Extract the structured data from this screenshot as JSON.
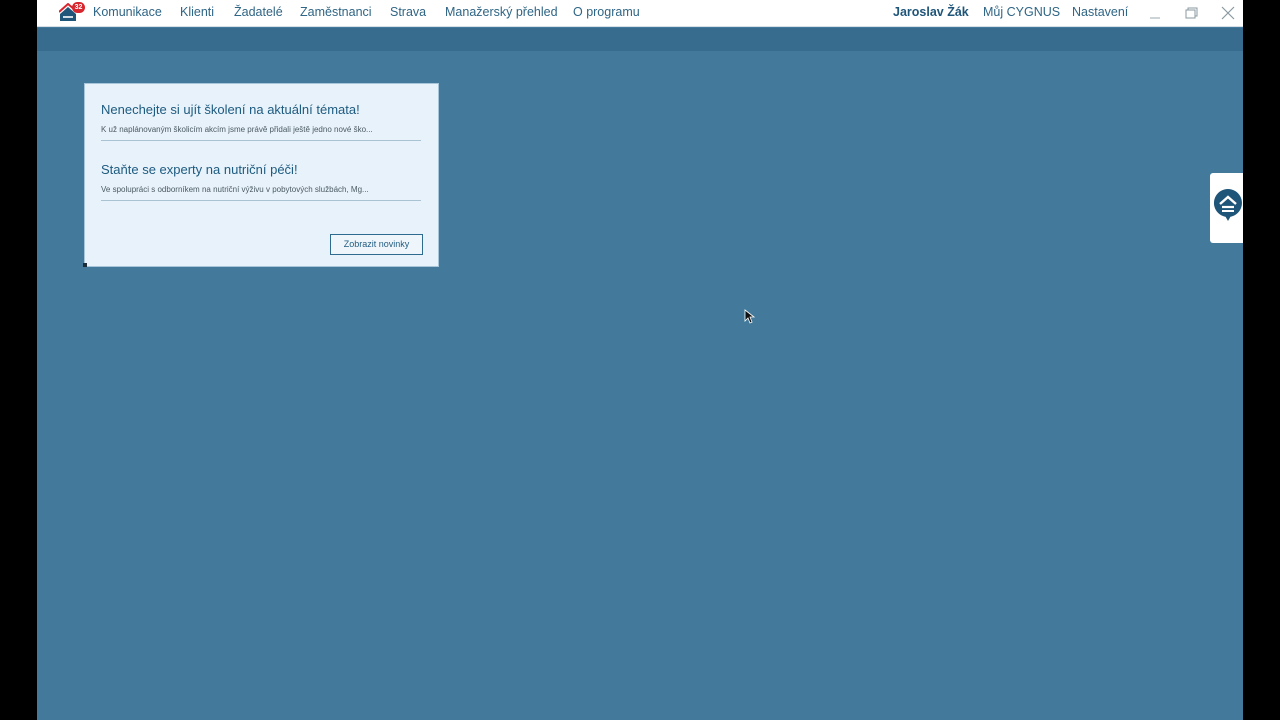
{
  "app": {
    "notification_count": "32",
    "colors": {
      "background": "#437a9b",
      "subbar": "#386c8f",
      "menubar": "#ffffff",
      "accent": "#1f5579",
      "badge": "#d8262e"
    }
  },
  "menu": {
    "items": [
      {
        "label": "Komunikace"
      },
      {
        "label": "Klienti"
      },
      {
        "label": "Žadatelé"
      },
      {
        "label": "Zaměstnanci"
      },
      {
        "label": "Strava"
      },
      {
        "label": "Manažerský přehled"
      },
      {
        "label": "O programu"
      }
    ],
    "user": "Jaroslav Žák",
    "my_cygnus": "Můj CYGNUS",
    "settings": "Nastavení"
  },
  "window_controls": {
    "minimize": "minimize-icon",
    "restore": "restore-icon",
    "close": "close-icon"
  },
  "news": {
    "items": [
      {
        "title": "Nenechejte si ujít školení na aktuální témata!",
        "text": "K už naplánovaným školicím akcím jsme právě přidali ještě jedno nové ško..."
      },
      {
        "title": "Staňte se experty na nutriční péči!",
        "text": "Ve spolupráci s odborníkem na nutriční výživu v pobytových službách, Mg..."
      }
    ],
    "button_label": "Zobrazit novinky"
  },
  "side_tab": {
    "icon": "cygnus-chat-icon"
  }
}
